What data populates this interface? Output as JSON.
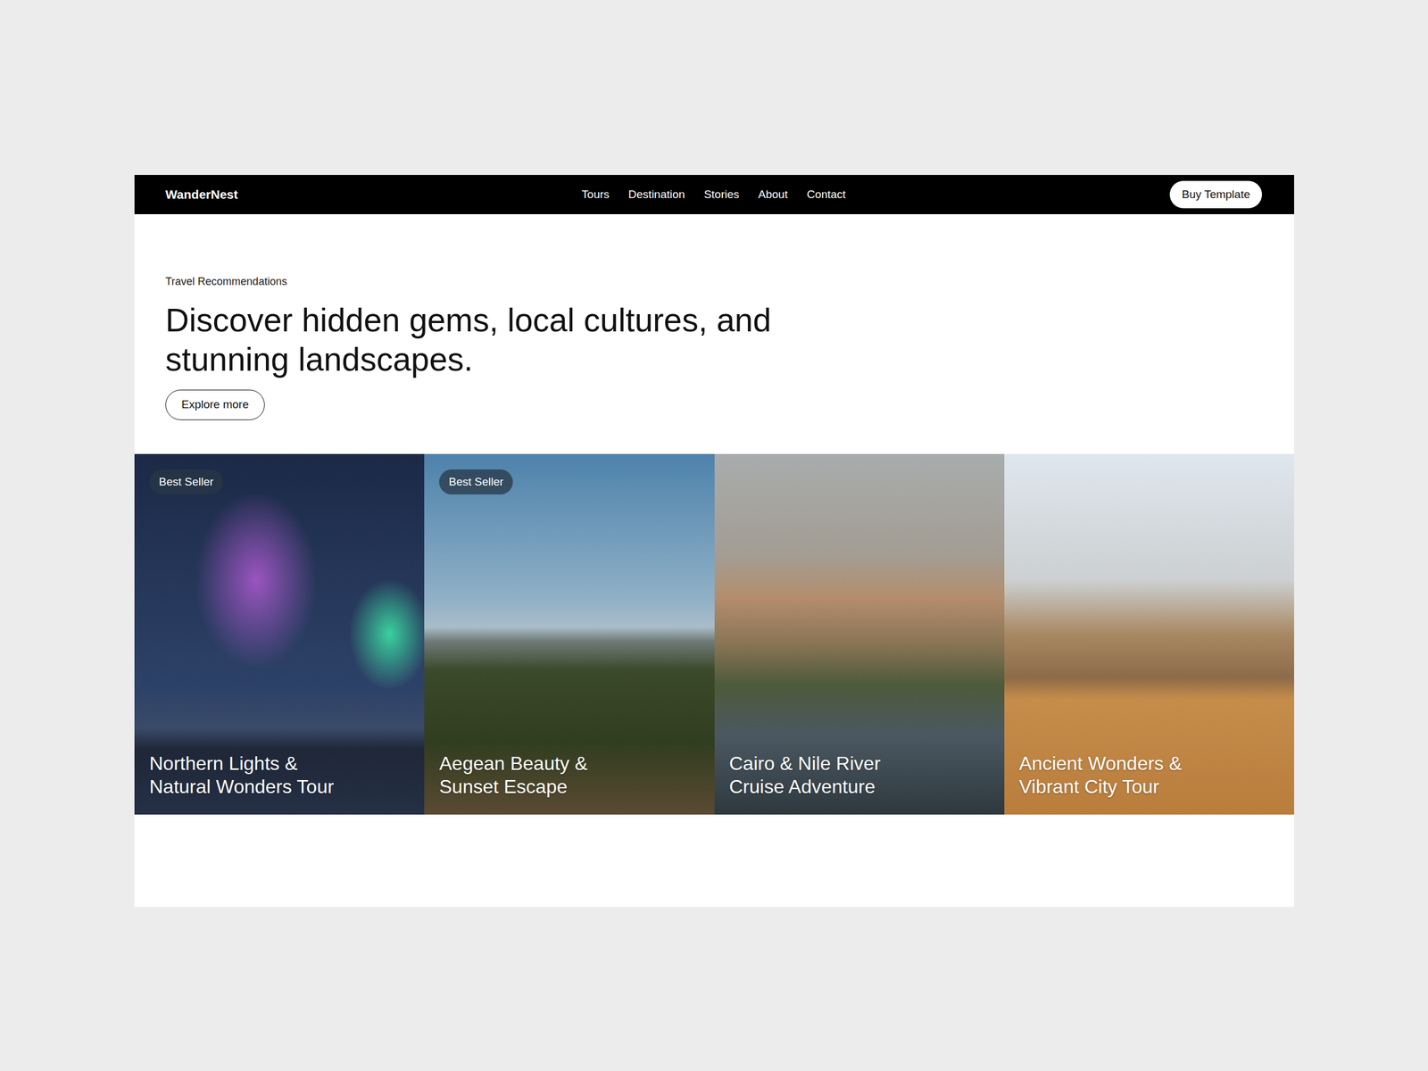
{
  "brand": "WanderNest",
  "nav": {
    "links": [
      "Tours",
      "Destination",
      "Stories",
      "About",
      "Contact"
    ],
    "cta": "Buy Template"
  },
  "hero": {
    "eyebrow": "Travel Recommendations",
    "heading": "Discover hidden gems, local cultures, and stunning landscapes.",
    "button": "Explore more"
  },
  "tours": [
    {
      "title": "Northern Lights & Natural Wonders Tour",
      "badge": "Best Seller"
    },
    {
      "title": "Aegean Beauty & Sunset Escape",
      "badge": "Best Seller"
    },
    {
      "title": "Cairo & Nile River Cruise Adventure"
    },
    {
      "title": "Ancient Wonders & Vibrant City Tour"
    }
  ]
}
